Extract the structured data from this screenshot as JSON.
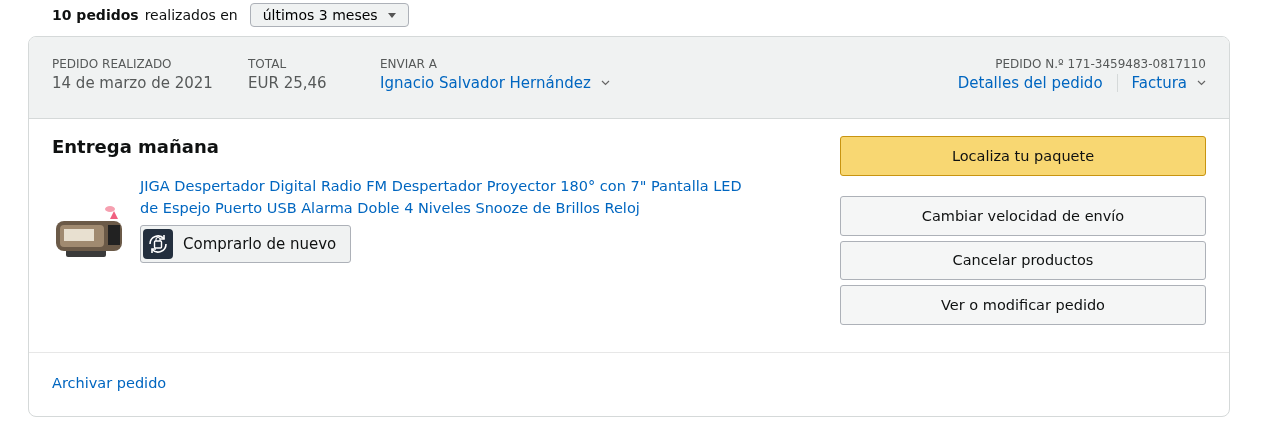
{
  "summary": {
    "count": "10 pedidos",
    "text": "realizados en",
    "period": {
      "value": "últimos 3 meses"
    }
  },
  "order": {
    "header": {
      "placed": {
        "label": "PEDIDO REALIZADO",
        "value": "14 de marzo de 2021"
      },
      "total": {
        "label": "TOTAL",
        "value": "EUR 25,46"
      },
      "ship_to": {
        "label": "ENVIAR A",
        "value": "Ignacio Salvador Hernández"
      },
      "order_number": "PEDIDO N.º 171-3459483-0817110",
      "links": [
        "Detalles del pedido",
        "Factura"
      ]
    },
    "status": "Entrega mañana",
    "item": {
      "title": "JIGA Despertador Digital Radio FM Despertador Proyector 180° con 7\" Pantalla LED de Espejo Puerto USB Alarma Doble 4 Niveles Snooze de Brillos Reloj",
      "buy_again": "Comprarlo de nuevo"
    },
    "actions": [
      {
        "label": "Localiza tu paquete",
        "kind": "primary"
      },
      {
        "label": "Cambiar velocidad de envío",
        "kind": "secondary"
      },
      {
        "label": "Cancelar productos",
        "kind": "secondary"
      },
      {
        "label": "Ver o modificar pedido",
        "kind": "secondary"
      }
    ],
    "footer_link": "Archivar pedido"
  }
}
